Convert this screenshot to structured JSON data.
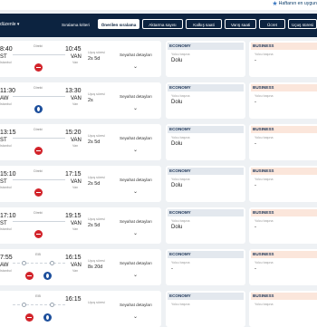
{
  "favorite_link": "Haftanın en uygun",
  "sort_bar": {
    "edit_label": "düzenle",
    "criteria_label": "Sıralama kriteri",
    "buttons": [
      {
        "label": "Önerilen sıralama",
        "active": true
      },
      {
        "label": "Aktarma sayısı",
        "active": false
      },
      {
        "label": "Kalkış saati",
        "active": false
      },
      {
        "label": "Varış saati",
        "active": false
      },
      {
        "label": "Ücret",
        "active": false
      },
      {
        "label": "Uçuş süresi",
        "active": false
      }
    ]
  },
  "common": {
    "stop_label": "Direkt",
    "duration_label": "Uçuş süresi",
    "details_label": "Seyahat detayları",
    "economy": "ECONOMY",
    "business": "BUSINESS",
    "fare_sub": "Yolcu başına"
  },
  "flights": [
    {
      "dep_time": "8:40",
      "dep_code": "ST",
      "dep_sub": "Istanbul",
      "arr_time": "10:45",
      "arr_code": "VAN",
      "arr_sub": "Van",
      "duration": "2s 5d",
      "airline": "tk",
      "stops": 0,
      "economy": "Dolu",
      "business": "-"
    },
    {
      "dep_time": "11:30",
      "dep_code": "AW",
      "dep_sub": "Istanbul",
      "arr_time": "13:30",
      "arr_code": "VAN",
      "arr_sub": "Van",
      "duration": "2s",
      "airline": "aj",
      "stops": 0,
      "economy": "Dolu",
      "business": "-"
    },
    {
      "dep_time": "13:15",
      "dep_code": "ST",
      "dep_sub": "Istanbul",
      "arr_time": "15:20",
      "arr_code": "VAN",
      "arr_sub": "Van",
      "duration": "2s 5d",
      "airline": "tk",
      "stops": 0,
      "economy": "Dolu",
      "business": "-"
    },
    {
      "dep_time": "15:10",
      "dep_code": "ST",
      "dep_sub": "Istanbul",
      "arr_time": "17:15",
      "arr_code": "VAN",
      "arr_sub": "Van",
      "duration": "2s 5d",
      "airline": "tk",
      "stops": 0,
      "economy": "Dolu",
      "business": "-"
    },
    {
      "dep_time": "17:10",
      "dep_code": "ST",
      "dep_sub": "Istanbul",
      "arr_time": "19:15",
      "arr_code": "VAN",
      "arr_sub": "Van",
      "duration": "2s 5d",
      "airline": "tk",
      "stops": 0,
      "economy": "Dolu",
      "business": "-"
    },
    {
      "dep_time": "7:55",
      "dep_code": "AW",
      "dep_sub": "Istanbul",
      "arr_time": "16:15",
      "arr_code": "VAN",
      "arr_sub": "Van",
      "duration": "8s 20d",
      "airline": "aj2",
      "stops": 2,
      "stop_label": "EIB",
      "economy": "-",
      "business": "-"
    },
    {
      "dep_time": "",
      "dep_code": "",
      "dep_sub": "",
      "arr_time": "16:15",
      "arr_code": "",
      "arr_sub": "",
      "duration": "",
      "airline": "aj2",
      "stops": 2,
      "stop_label": "EIB",
      "economy": "",
      "business": ""
    }
  ]
}
